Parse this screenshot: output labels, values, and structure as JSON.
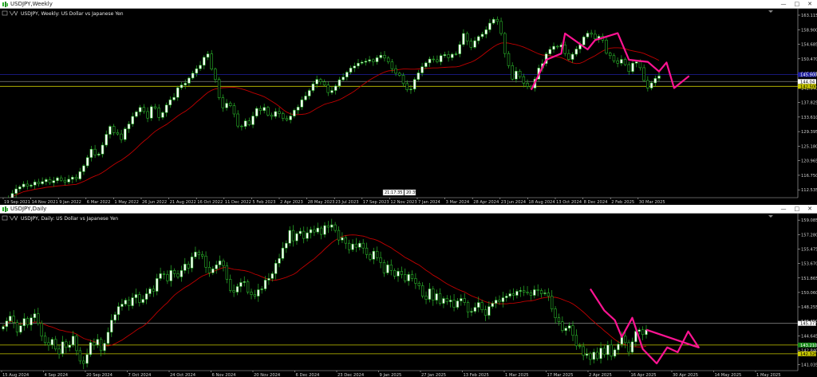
{
  "charts": [
    {
      "window_title": "USDJPY,Weekly",
      "header_text": "USDJPY, Weekly:  US Dollar vs Japanese Yen",
      "price_axis": [
        163.115,
        158.9,
        154.685,
        150.47,
        146.255,
        142.04,
        137.825,
        133.61,
        129.395,
        125.18,
        120.965,
        116.75,
        112.535
      ],
      "time_axis": [
        "19 Sep 2021",
        "14 Nov 2021",
        "9 Jan 2022",
        "6 Mar 2022",
        "1 May 2022",
        "26 Jun 2022",
        "21 Aug 2022",
        "16 Oct 2022",
        "11 Dec 2022",
        "5 Feb 2023",
        "2 Apr 2023",
        "28 May 2023",
        "23 Jul 2023",
        "17 Sep 2023",
        "12 Nov 2023",
        "7 Jan 2024",
        "3 Mar 2024",
        "28 Apr 2024",
        "23 Jun 2024",
        "18 Aug 2024",
        "13 Oct 2024",
        "8 Dec 2024",
        "2 Feb 2025",
        "30 Mar 2025"
      ],
      "price_tags": {
        "current": "144.04",
        "h_line": "143.286",
        "blue_line": "145.900",
        "yellow_line": "142.500"
      },
      "crosshair_labels": [
        "21:17:35",
        "20:39"
      ],
      "colors": {
        "bull": "#2ab52a",
        "bull_body": "#ffffff",
        "ma": "#c00000",
        "pattern": "#ff1493",
        "h_blue": "#2020a0",
        "h_yellow": "#c8c800"
      }
    },
    {
      "window_title": "USDJPY,Daily",
      "header_text": "USDJPY, Daily:  US Dollar vs Japanese Yen",
      "price_axis": [
        159.085,
        157.28,
        155.475,
        153.67,
        151.865,
        150.06,
        148.255,
        146.45,
        144.645,
        142.84,
        141.035
      ],
      "time_axis": [
        "15 Aug 2024",
        "4 Sep 2024",
        "20 Sep 2024",
        "7 Oct 2024",
        "24 Oct 2024",
        "6 Nov 2024",
        "20 Nov 2024",
        "6 Dec 2024",
        "23 Dec 2024",
        "9 Jan 2025",
        "27 Jan 2025",
        "13 Feb 2025",
        "1 Mar 2025",
        "17 Mar 2025",
        "2 Apr 2025",
        "16 Apr 2025",
        "30 Apr 2025",
        "14 May 2025",
        "1 May 2025"
      ],
      "price_tags": {
        "current": "145.371",
        "yellow_line": "143.500",
        "green_tag": "143.210",
        "yellow_tag": "142.325"
      },
      "colors": {
        "bull": "#2ab52a",
        "ma": "#c00000",
        "pattern": "#ff1493",
        "h_gray": "#808080",
        "h_yellow": "#c8c800"
      }
    }
  ],
  "chart_data": [
    {
      "type": "candlestick",
      "title": "USDJPY, Weekly:  US Dollar vs Japanese Yen",
      "ylim": [
        110.5,
        164.5
      ],
      "close_series": [
        109.9,
        110.2,
        111.5,
        112.8,
        113.4,
        114.2,
        113.6,
        113.9,
        114.8,
        114.3,
        114.9,
        115.5,
        114.6,
        115.2,
        116.0,
        115.3,
        114.8,
        115.6,
        116.2,
        115.7,
        117.8,
        119.5,
        121.9,
        124.3,
        122.6,
        122.9,
        125.5,
        128.6,
        130.9,
        129.1,
        128.7,
        127.1,
        130.2,
        131.6,
        133.8,
        135.1,
        136.4,
        135.2,
        133.3,
        136.6,
        136.2,
        133.5,
        134.9,
        137.1,
        138.6,
        139.3,
        142.1,
        142.9,
        143.4,
        144.9,
        146.3,
        147.6,
        148.6,
        150.9,
        151.9,
        147.5,
        144.5,
        139.2,
        136.3,
        137.6,
        136.9,
        134.5,
        131.0,
        130.9,
        132.5,
        131.4,
        133.9,
        136.1,
        135.5,
        136.4,
        134.2,
        133.8,
        135.2,
        134.6,
        133.2,
        132.8,
        133.9,
        135.6,
        136.5,
        138.6,
        139.7,
        141.3,
        143.2,
        144.5,
        143.8,
        142.9,
        140.7,
        141.3,
        142.6,
        144.4,
        145.2,
        146.6,
        147.8,
        148.4,
        149.2,
        149.5,
        149.8,
        150.2,
        149.6,
        150.8,
        151.5,
        150.7,
        149.6,
        147.6,
        146.3,
        145.7,
        143.3,
        141.5,
        141.7,
        144.5,
        146.4,
        148.2,
        149.3,
        150.4,
        150.2,
        149.6,
        151.4,
        151.7,
        150.8,
        151.8,
        151.9,
        154.6,
        157.8,
        155.6,
        153.8,
        155.7,
        156.9,
        157.6,
        158.9,
        160.8,
        161.9,
        161.3,
        157.8,
        152.0,
        148.5,
        144.6,
        146.9,
        145.3,
        143.4,
        142.5,
        142.0,
        144.6,
        147.8,
        149.1,
        151.9,
        153.2,
        154.1,
        153.9,
        154.5,
        152.0,
        150.3,
        151.8,
        153.3,
        154.5,
        156.8,
        157.9,
        157.6,
        156.3,
        157.0,
        155.9,
        152.1,
        151.4,
        149.9,
        149.2,
        150.3,
        148.8,
        146.8,
        149.2,
        149.6,
        147.9,
        144.2,
        142.0,
        143.5,
        144.8,
        145.5
      ],
      "series": [
        {
          "name": "Moving Average",
          "values": "derived smoothing of close_series"
        }
      ],
      "pattern_polyline": [
        [
          140,
          141.5
        ],
        [
          144,
          150.2
        ],
        [
          148,
          152.0
        ],
        [
          149,
          157.8
        ],
        [
          155,
          153.2
        ],
        [
          157,
          155.9
        ],
        [
          163,
          157.9
        ],
        [
          166,
          150.2
        ],
        [
          171,
          149.6
        ],
        [
          174,
          146.8
        ],
        [
          176,
          149.4
        ],
        [
          178,
          142.0
        ],
        [
          182,
          145.5
        ]
      ],
      "x_ticks": [
        "19 Sep 2021",
        "14 Nov 2021",
        "9 Jan 2022",
        "6 Mar 2022",
        "1 May 2022",
        "26 Jun 2022",
        "21 Aug 2022",
        "16 Oct 2022",
        "11 Dec 2022",
        "5 Feb 2023",
        "2 Apr 2023",
        "28 May 2023",
        "23 Jul 2023",
        "17 Sep 2023",
        "12 Nov 2023",
        "7 Jan 2024",
        "3 Mar 2024",
        "28 Apr 2024",
        "23 Jun 2024",
        "18 Aug 2024",
        "13 Oct 2024",
        "8 Dec 2024",
        "2 Feb 2025",
        "30 Mar 2025"
      ]
    },
    {
      "type": "candlestick",
      "title": "USDJPY, Daily:  US Dollar vs Japanese Yen",
      "ylim": [
        140.4,
        159.7
      ],
      "close_series": [
        145.8,
        146.5,
        147.1,
        146.3,
        145.1,
        145.9,
        146.8,
        146.0,
        146.9,
        147.4,
        146.2,
        144.6,
        143.8,
        143.5,
        144.2,
        143.0,
        142.4,
        143.9,
        143.2,
        143.5,
        144.6,
        142.8,
        141.5,
        141.2,
        142.3,
        143.8,
        143.5,
        144.2,
        142.8,
        143.7,
        145.1,
        146.6,
        147.3,
        148.3,
        148.6,
        149.1,
        148.4,
        149.4,
        149.8,
        148.8,
        149.2,
        149.9,
        150.5,
        150.2,
        151.8,
        152.4,
        152.3,
        151.5,
        152.8,
        152.4,
        152.0,
        152.8,
        153.6,
        153.1,
        154.5,
        155.1,
        154.8,
        154.6,
        153.2,
        152.5,
        153.0,
        153.5,
        154.0,
        153.4,
        151.7,
        150.3,
        150.1,
        150.8,
        151.3,
        151.4,
        150.1,
        149.8,
        149.6,
        150.4,
        150.5,
        151.6,
        151.8,
        152.4,
        153.7,
        154.3,
        155.6,
        156.2,
        157.8,
        156.5,
        157.4,
        157.7,
        156.8,
        157.5,
        157.9,
        157.6,
        158.1,
        157.3,
        158.4,
        158.2,
        158.5,
        157.8,
        156.6,
        156.9,
        156.2,
        155.4,
        156.1,
        155.7,
        156.2,
        155.6,
        154.8,
        154.2,
        155.2,
        154.4,
        153.8,
        152.5,
        153.5,
        152.8,
        152.1,
        152.7,
        152.3,
        151.5,
        152.3,
        151.8,
        151.2,
        150.9,
        149.6,
        149.2,
        150.5,
        149.1,
        149.9,
        148.7,
        149.3,
        148.9,
        149.1,
        148.2,
        149.0,
        149.3,
        148.8,
        147.6,
        147.7,
        148.2,
        148.8,
        147.9,
        147.2,
        148.3,
        148.7,
        149.1,
        148.9,
        149.4,
        149.6,
        149.9,
        149.7,
        150.2,
        150.3,
        150.1,
        150.0,
        149.7,
        150.4,
        150.3,
        149.9,
        150.0,
        149.6,
        148.0,
        146.9,
        146.4,
        145.3,
        145.6,
        145.9,
        144.7,
        143.4,
        143.3,
        142.2,
        142.4,
        141.7,
        142.6,
        141.8,
        143.1,
        142.3,
        143.5,
        142.1,
        142.9,
        143.6,
        144.6,
        143.8,
        142.6,
        143.9,
        145.2,
        145.4,
        144.8,
        145.4
      ]
    }
  ]
}
